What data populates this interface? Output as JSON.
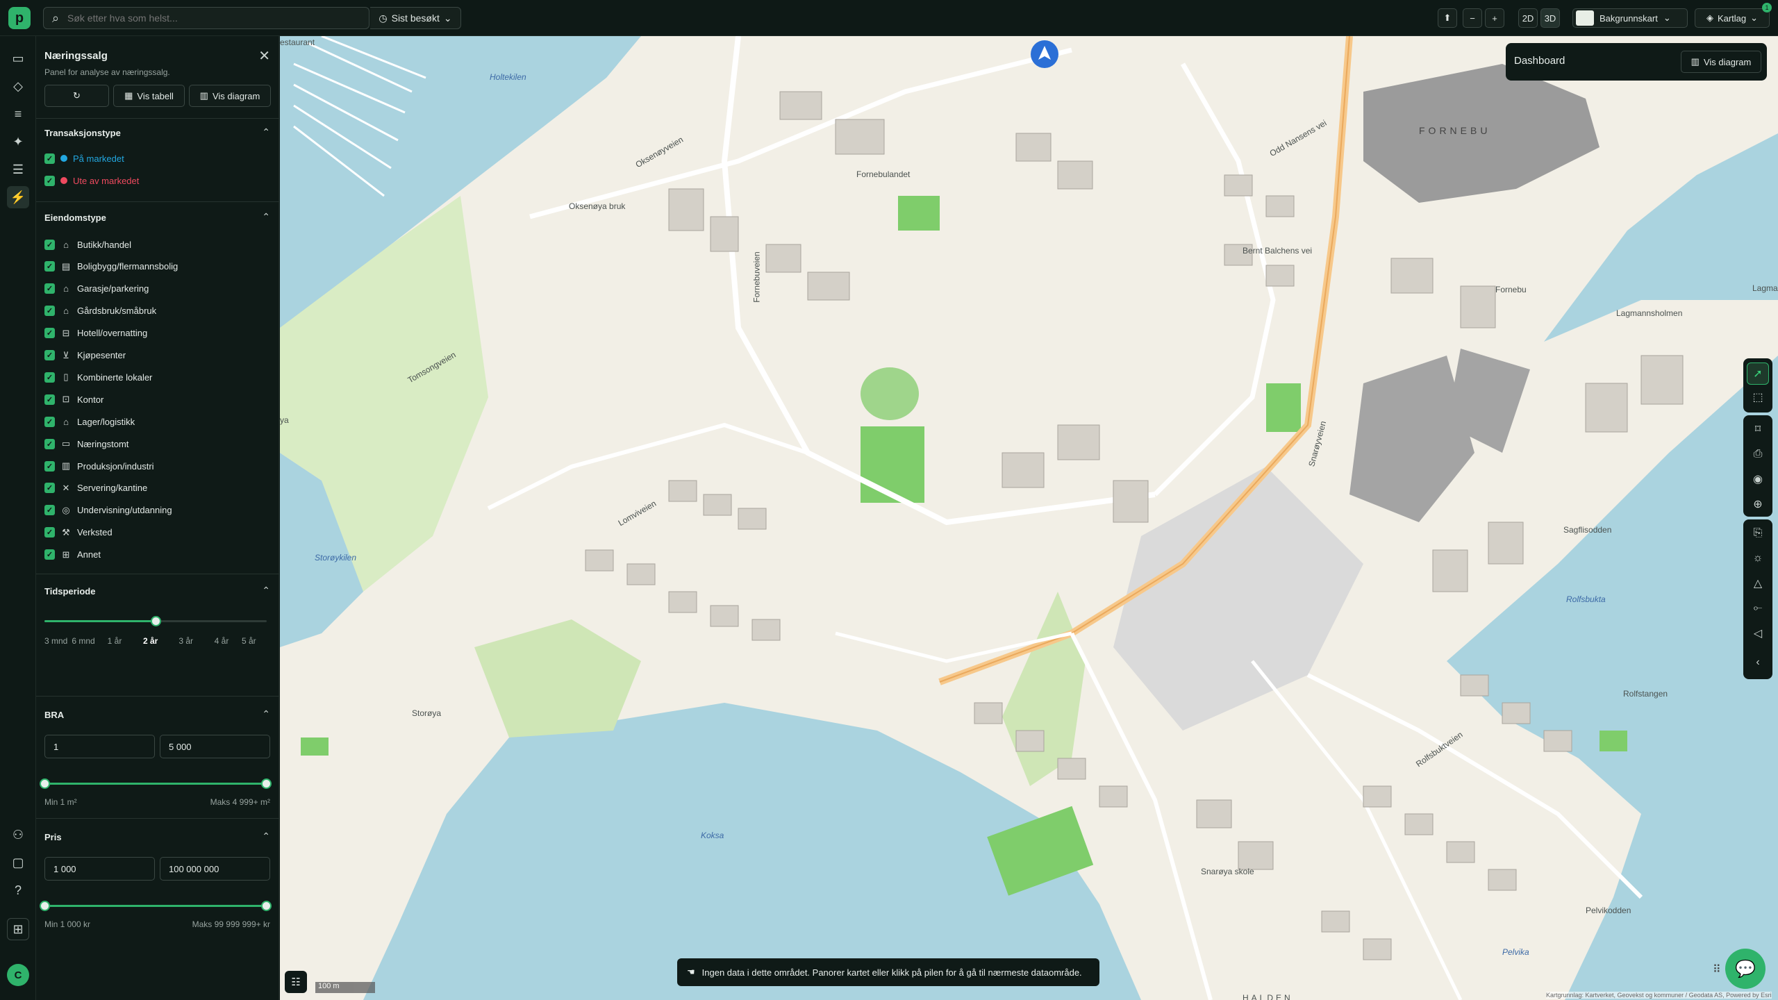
{
  "search": {
    "placeholder": "Søk etter hva som helst..."
  },
  "topbar": {
    "recent_label": "Sist besøkt",
    "zoom_out": "−",
    "zoom_in": "+",
    "view_2d": "2D",
    "view_3d": "3D",
    "basemap_label": "Bakgrunnskart",
    "layers_label": "Kartlag",
    "layers_badge": "1"
  },
  "user": {
    "initial": "C"
  },
  "panel": {
    "title": "Næringssalg",
    "subtitle": "Panel for analyse av næringssalg.",
    "btn_table": "Vis tabell",
    "btn_chart": "Vis diagram",
    "transaction": {
      "title": "Transaksjonstype",
      "items": [
        {
          "label": "På markedet",
          "color": "#22a7e0"
        },
        {
          "label": "Ute av markedet",
          "color": "#ef4a5f"
        }
      ]
    },
    "property": {
      "title": "Eiendomstype",
      "items": [
        {
          "label": "Butikk/handel",
          "icon": "shop-icon"
        },
        {
          "label": "Boligbygg/flermannsbolig",
          "icon": "apartment-icon"
        },
        {
          "label": "Garasje/parkering",
          "icon": "garage-icon"
        },
        {
          "label": "Gårdsbruk/småbruk",
          "icon": "farm-icon"
        },
        {
          "label": "Hotell/overnatting",
          "icon": "bed-icon"
        },
        {
          "label": "Kjøpesenter",
          "icon": "cart-icon"
        },
        {
          "label": "Kombinerte lokaler",
          "icon": "building-icon"
        },
        {
          "label": "Kontor",
          "icon": "briefcase-icon"
        },
        {
          "label": "Lager/logistikk",
          "icon": "warehouse-icon"
        },
        {
          "label": "Næringstomt",
          "icon": "plot-icon"
        },
        {
          "label": "Produksjon/industri",
          "icon": "factory-icon"
        },
        {
          "label": "Servering/kantine",
          "icon": "cutlery-icon"
        },
        {
          "label": "Undervisning/utdanning",
          "icon": "school-icon"
        },
        {
          "label": "Verksted",
          "icon": "wrench-icon"
        },
        {
          "label": "Annet",
          "icon": "grid-icon"
        }
      ]
    },
    "period": {
      "title": "Tidsperiode",
      "ticks": [
        "3 mnd",
        "6 mnd",
        "1 år",
        "2 år",
        "3 år",
        "4 år",
        "5 år"
      ],
      "selected": "2 år",
      "selected_fraction": 0.5
    },
    "bra": {
      "title": "BRA",
      "min_value": "1",
      "max_value": "5 000",
      "min_label": "Min 1 m²",
      "max_label": "Maks 4 999+ m²",
      "range_fraction": [
        0,
        1
      ]
    },
    "price": {
      "title": "Pris",
      "min_value": "1 000",
      "max_value": "100 000 000",
      "min_label": "Min 1 000 kr",
      "max_label": "Maks 99 999 999+ kr",
      "range_fraction": [
        0,
        1
      ]
    }
  },
  "dashboard": {
    "title": "Dashboard",
    "btn": "Vis diagram"
  },
  "map": {
    "labels": {
      "fornebu": "FORNEBU",
      "fornebulandet": "Fornebulandet",
      "oksenoya": "Oksenøya bruk",
      "storoya": "Storøya",
      "holtekilen": "Holtekilen",
      "storoykilen": "Storøykilen",
      "koksa": "Koksa",
      "rolfsbukta": "Rolfsbukta",
      "sagbukta": "Sagflisodden",
      "lagmannsholmen": "Lagmannsholmen",
      "rolfstangen": "Rolfstangen",
      "pelvikodden": "Pelvikodden",
      "pelvika": "Pelvika",
      "bernt": "Bernt Balchens vei",
      "fornebu_r": "Fornebu",
      "snaroya": "Snarøya skole",
      "lagma": "Lagma",
      "restaurant": "estaurant",
      "ya": "ya",
      "halden": "HALDEN",
      "fornebuvegen": "Fornebuveien",
      "rolfsbuktveien": "Rolfsbuktveien",
      "snaroyveien": "Snarøyveien",
      "lomviveien": "Lomviveien",
      "tomsongen": "Tomsongveien",
      "oksenoyveien": "Oksenøyveien",
      "odd": "Odd Nansens vei"
    },
    "toast": "Ingen data i dette området. Panorer kartet eller klikk på pilen for å gå til nærmeste dataområde.",
    "scale": "100 m",
    "attribution": "Kartgrunnlag: Kartverket, Geovekst og kommuner / Geodata AS, Powered by Esri"
  }
}
